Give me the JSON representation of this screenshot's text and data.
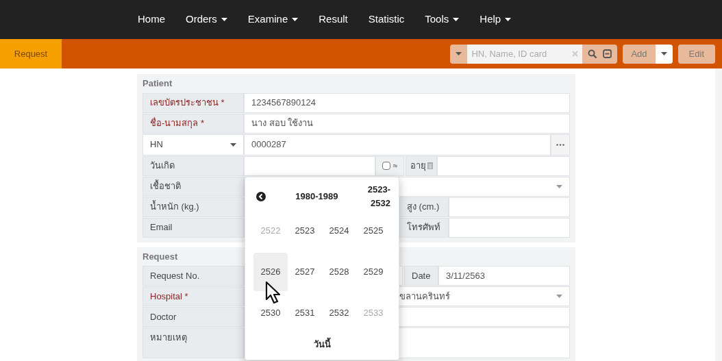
{
  "nav": [
    {
      "label": "Home",
      "dropdown": false
    },
    {
      "label": "Orders",
      "dropdown": true
    },
    {
      "label": "Examine",
      "dropdown": true
    },
    {
      "label": "Result",
      "dropdown": false
    },
    {
      "label": "Statistic",
      "dropdown": false
    },
    {
      "label": "Tools",
      "dropdown": true
    },
    {
      "label": "Help",
      "dropdown": true
    }
  ],
  "toolbar": {
    "tabs": [
      {
        "label": "Request",
        "selected": true
      }
    ],
    "search": {
      "placeholder": "HN, Name, ID card"
    },
    "add": "Add",
    "edit": "Edit"
  },
  "patient": {
    "title": "Patient",
    "id_card": {
      "label": "เลขบัตรประชาชน *",
      "required": true,
      "value": "1234567890124"
    },
    "name": {
      "label": "ชื่อ-นามสกุล *",
      "required": true,
      "value": "นาง สอบ ใช้งาน"
    },
    "hn": {
      "label": "HN",
      "value": "0000287"
    },
    "birthdate": {
      "label": "วันเกิด",
      "approx_checked": false,
      "approx": "≈",
      "age_label": "อายุ"
    },
    "nationality": {
      "label": "เชื้อชาติ"
    },
    "weight": {
      "label": "น้ำหนัก (kg.)"
    },
    "height": {
      "label": "สูง (cm.)"
    },
    "email": {
      "label": "Email"
    },
    "phone": {
      "label": "โทรศัพท์"
    }
  },
  "request": {
    "title": "Request",
    "request_no": {
      "label": "Request No."
    },
    "date": {
      "label": "Date",
      "value": "3/11/2563"
    },
    "hospital": {
      "label": "Hospital *",
      "required": true,
      "value": "ขลานครินทร์"
    },
    "doctor": {
      "label": "Doctor"
    },
    "note": {
      "label": "หมายเหตุ"
    }
  },
  "datepicker": {
    "range": "1980-1989",
    "range_be": "2523-\n2532",
    "today": "วันนี้",
    "years": [
      {
        "label": "2522",
        "muted": true,
        "highlighted": false
      },
      {
        "label": "2523",
        "muted": false,
        "highlighted": false
      },
      {
        "label": "2524",
        "muted": false,
        "highlighted": false
      },
      {
        "label": "2525",
        "muted": false,
        "highlighted": false
      },
      {
        "label": "2526",
        "muted": false,
        "highlighted": true
      },
      {
        "label": "2527",
        "muted": false,
        "highlighted": false
      },
      {
        "label": "2528",
        "muted": false,
        "highlighted": false
      },
      {
        "label": "2529",
        "muted": false,
        "highlighted": false
      },
      {
        "label": "2530",
        "muted": false,
        "highlighted": false
      },
      {
        "label": "2531",
        "muted": false,
        "highlighted": false
      },
      {
        "label": "2532",
        "muted": false,
        "highlighted": false
      },
      {
        "label": "2533",
        "muted": true,
        "highlighted": false
      }
    ]
  }
}
